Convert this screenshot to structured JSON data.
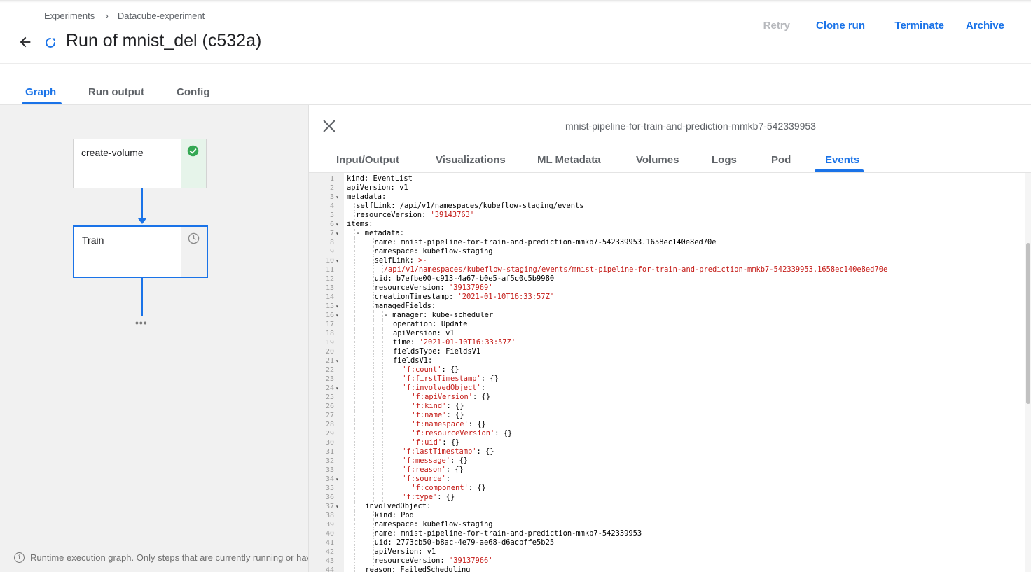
{
  "breadcrumb": {
    "items": [
      "Experiments",
      "Datacube-experiment"
    ],
    "separator": "›"
  },
  "header": {
    "title": "Run of mnist_del (c532a)"
  },
  "actions": {
    "retry": "Retry",
    "clone": "Clone run",
    "terminate": "Terminate",
    "archive": "Archive"
  },
  "main_tabs": [
    "Graph",
    "Run output",
    "Config"
  ],
  "graph": {
    "nodes": [
      {
        "label": "create-volume",
        "status": "succeeded"
      },
      {
        "label": "Train",
        "status": "pending"
      }
    ],
    "more": "•••",
    "footer_icon": "i",
    "footer": "Runtime execution graph. Only steps that are currently running or have already completed are shown."
  },
  "panel": {
    "title": "mnist-pipeline-for-train-and-prediction-mmkb7-542339953",
    "tabs": [
      "Input/Output",
      "Visualizations",
      "ML Metadata",
      "Volumes",
      "Logs",
      "Pod",
      "Events"
    ],
    "active_tab": "Events"
  },
  "colors": {
    "accent": "#1a73e8",
    "success": "#34a853",
    "string": "#c41a16"
  },
  "code": [
    {
      "n": "1",
      "f": "",
      "i": 0,
      "t": [
        [
          "k",
          "kind: EventList"
        ]
      ]
    },
    {
      "n": "2",
      "f": "",
      "i": 0,
      "t": [
        [
          "k",
          "apiVersion: v1"
        ]
      ]
    },
    {
      "n": "3",
      "f": "▾",
      "i": 0,
      "t": [
        [
          "k",
          "metadata:"
        ]
      ]
    },
    {
      "n": "4",
      "f": "",
      "i": 1,
      "t": [
        [
          "k",
          "selfLink: /api/v1/namespaces/kubeflow-staging/events"
        ]
      ]
    },
    {
      "n": "5",
      "f": "",
      "i": 1,
      "t": [
        [
          "k",
          "resourceVersion: "
        ],
        [
          "s",
          "'39143763'"
        ]
      ]
    },
    {
      "n": "6",
      "f": "▾",
      "i": 0,
      "t": [
        [
          "k",
          "items:"
        ]
      ]
    },
    {
      "n": "7",
      "f": "▾",
      "i": 1,
      "t": [
        [
          "k",
          "- metadata:"
        ]
      ]
    },
    {
      "n": "8",
      "f": "",
      "i": 3,
      "t": [
        [
          "k",
          "name: mnist-pipeline-for-train-and-prediction-mmkb7-542339953.1658ec140e8ed70e"
        ]
      ]
    },
    {
      "n": "9",
      "f": "",
      "i": 3,
      "t": [
        [
          "k",
          "namespace: kubeflow-staging"
        ]
      ]
    },
    {
      "n": "10",
      "f": "▾",
      "i": 3,
      "t": [
        [
          "k",
          "selfLink: "
        ],
        [
          "s",
          ">-"
        ]
      ]
    },
    {
      "n": "11",
      "f": "",
      "i": 4,
      "t": [
        [
          "s",
          "/api/v1/namespaces/kubeflow-staging/events/mnist-pipeline-for-train-and-prediction-mmkb7-542339953.1658ec140e8ed70e"
        ]
      ]
    },
    {
      "n": "12",
      "f": "",
      "i": 3,
      "t": [
        [
          "k",
          "uid: b7efbe00-c913-4a67-b0e5-af5c0c5b9980"
        ]
      ]
    },
    {
      "n": "13",
      "f": "",
      "i": 3,
      "t": [
        [
          "k",
          "resourceVersion: "
        ],
        [
          "s",
          "'39137969'"
        ]
      ]
    },
    {
      "n": "14",
      "f": "",
      "i": 3,
      "t": [
        [
          "k",
          "creationTimestamp: "
        ],
        [
          "s",
          "'2021-01-10T16:33:57Z'"
        ]
      ]
    },
    {
      "n": "15",
      "f": "▾",
      "i": 3,
      "t": [
        [
          "k",
          "managedFields:"
        ]
      ]
    },
    {
      "n": "16",
      "f": "▾",
      "i": 4,
      "t": [
        [
          "k",
          "- manager: kube-scheduler"
        ]
      ]
    },
    {
      "n": "17",
      "f": "",
      "i": 5,
      "t": [
        [
          "k",
          "operation: Update"
        ]
      ]
    },
    {
      "n": "18",
      "f": "",
      "i": 5,
      "t": [
        [
          "k",
          "apiVersion: v1"
        ]
      ]
    },
    {
      "n": "19",
      "f": "",
      "i": 5,
      "t": [
        [
          "k",
          "time: "
        ],
        [
          "s",
          "'2021-01-10T16:33:57Z'"
        ]
      ]
    },
    {
      "n": "20",
      "f": "",
      "i": 5,
      "t": [
        [
          "k",
          "fieldsType: FieldsV1"
        ]
      ]
    },
    {
      "n": "21",
      "f": "▾",
      "i": 5,
      "t": [
        [
          "k",
          "fieldsV1:"
        ]
      ]
    },
    {
      "n": "22",
      "f": "",
      "i": 6,
      "t": [
        [
          "s",
          "'f:count'"
        ],
        [
          "k",
          ": {}"
        ]
      ]
    },
    {
      "n": "23",
      "f": "",
      "i": 6,
      "t": [
        [
          "s",
          "'f:firstTimestamp'"
        ],
        [
          "k",
          ": {}"
        ]
      ]
    },
    {
      "n": "24",
      "f": "▾",
      "i": 6,
      "t": [
        [
          "s",
          "'f:involvedObject'"
        ],
        [
          "k",
          ":"
        ]
      ]
    },
    {
      "n": "25",
      "f": "",
      "i": 7,
      "t": [
        [
          "s",
          "'f:apiVersion'"
        ],
        [
          "k",
          ": {}"
        ]
      ]
    },
    {
      "n": "26",
      "f": "",
      "i": 7,
      "t": [
        [
          "s",
          "'f:kind'"
        ],
        [
          "k",
          ": {}"
        ]
      ]
    },
    {
      "n": "27",
      "f": "",
      "i": 7,
      "t": [
        [
          "s",
          "'f:name'"
        ],
        [
          "k",
          ": {}"
        ]
      ]
    },
    {
      "n": "28",
      "f": "",
      "i": 7,
      "t": [
        [
          "s",
          "'f:namespace'"
        ],
        [
          "k",
          ": {}"
        ]
      ]
    },
    {
      "n": "29",
      "f": "",
      "i": 7,
      "t": [
        [
          "s",
          "'f:resourceVersion'"
        ],
        [
          "k",
          ": {}"
        ]
      ]
    },
    {
      "n": "30",
      "f": "",
      "i": 7,
      "t": [
        [
          "s",
          "'f:uid'"
        ],
        [
          "k",
          ": {}"
        ]
      ]
    },
    {
      "n": "31",
      "f": "",
      "i": 6,
      "t": [
        [
          "s",
          "'f:lastTimestamp'"
        ],
        [
          "k",
          ": {}"
        ]
      ]
    },
    {
      "n": "32",
      "f": "",
      "i": 6,
      "t": [
        [
          "s",
          "'f:message'"
        ],
        [
          "k",
          ": {}"
        ]
      ]
    },
    {
      "n": "33",
      "f": "",
      "i": 6,
      "t": [
        [
          "s",
          "'f:reason'"
        ],
        [
          "k",
          ": {}"
        ]
      ]
    },
    {
      "n": "34",
      "f": "▾",
      "i": 6,
      "t": [
        [
          "s",
          "'f:source'"
        ],
        [
          "k",
          ":"
        ]
      ]
    },
    {
      "n": "35",
      "f": "",
      "i": 7,
      "t": [
        [
          "s",
          "'f:component'"
        ],
        [
          "k",
          ": {}"
        ]
      ]
    },
    {
      "n": "36",
      "f": "",
      "i": 6,
      "t": [
        [
          "s",
          "'f:type'"
        ],
        [
          "k",
          ": {}"
        ]
      ]
    },
    {
      "n": "37",
      "f": "▾",
      "i": 2,
      "t": [
        [
          "k",
          "involvedObject:"
        ]
      ]
    },
    {
      "n": "38",
      "f": "",
      "i": 3,
      "t": [
        [
          "k",
          "kind: Pod"
        ]
      ]
    },
    {
      "n": "39",
      "f": "",
      "i": 3,
      "t": [
        [
          "k",
          "namespace: kubeflow-staging"
        ]
      ]
    },
    {
      "n": "40",
      "f": "",
      "i": 3,
      "t": [
        [
          "k",
          "name: mnist-pipeline-for-train-and-prediction-mmkb7-542339953"
        ]
      ]
    },
    {
      "n": "41",
      "f": "",
      "i": 3,
      "t": [
        [
          "k",
          "uid: 2773cb50-b8ac-4e79-ae68-d6acbffe5b25"
        ]
      ]
    },
    {
      "n": "42",
      "f": "",
      "i": 3,
      "t": [
        [
          "k",
          "apiVersion: v1"
        ]
      ]
    },
    {
      "n": "43",
      "f": "",
      "i": 3,
      "t": [
        [
          "k",
          "resourceVersion: "
        ],
        [
          "s",
          "'39137966'"
        ]
      ]
    },
    {
      "n": "44",
      "f": "",
      "i": 2,
      "t": [
        [
          "k",
          "reason: FailedScheduling"
        ]
      ]
    }
  ]
}
